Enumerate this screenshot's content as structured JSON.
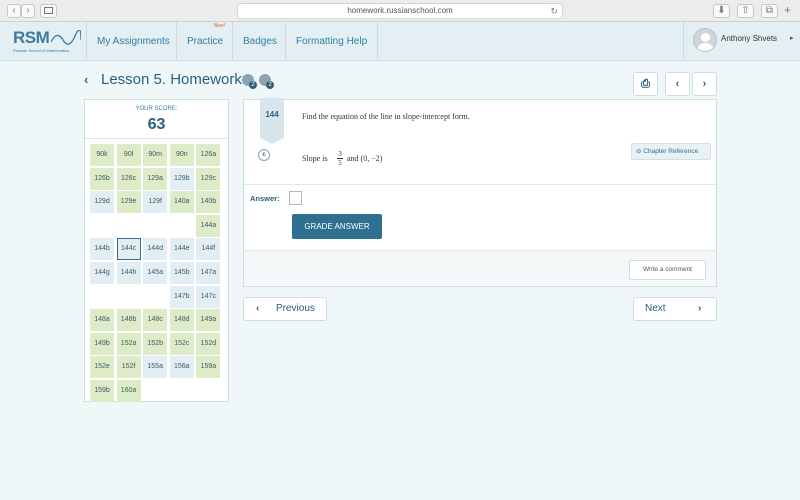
{
  "browser": {
    "url": "homework.russianschool.com",
    "back_glyph": "‹",
    "forward_glyph": "›",
    "reload_glyph": "↻",
    "download_glyph": "⬇",
    "share_glyph": "⇧",
    "tabs_glyph": "⧉",
    "plus_glyph": "+"
  },
  "logo": {
    "text": "RSM",
    "subtitle": "Russian School of Mathematics"
  },
  "nav": {
    "links": [
      {
        "label": "My Assignments"
      },
      {
        "label": "Practice",
        "badge": "New!"
      },
      {
        "label": "Badges"
      },
      {
        "label": "Formatting Help"
      }
    ],
    "user": {
      "name": "Anthony Shvets",
      "caret": "▸"
    }
  },
  "lesson": {
    "back_glyph": "‹",
    "title": "Lesson 5. Homework",
    "badges": [
      "2",
      "2"
    ],
    "print_glyph": "⎙",
    "prev_glyph": "‹",
    "next_glyph": "›"
  },
  "score": {
    "label": "YOUR SCORE:",
    "value": "63",
    "rows": [
      [
        {
          "t": "90k",
          "c": "g"
        },
        {
          "t": "90l",
          "c": "g"
        },
        {
          "t": "90m",
          "c": "g"
        },
        {
          "t": "90n",
          "c": "g"
        },
        {
          "t": "126a",
          "c": "g"
        }
      ],
      [
        {
          "t": "126b",
          "c": "g"
        },
        {
          "t": "126c",
          "c": "g"
        },
        {
          "t": "129a",
          "c": "g"
        },
        {
          "t": "129b",
          "c": "b"
        },
        {
          "t": "129c",
          "c": "g"
        }
      ],
      [
        {
          "t": "129d",
          "c": "b"
        },
        {
          "t": "129e",
          "c": "g"
        },
        {
          "t": "129f",
          "c": "b"
        },
        {
          "t": "140a",
          "c": "g"
        },
        {
          "t": "140b",
          "c": "g"
        }
      ],
      [
        {
          "t": "",
          "c": ""
        },
        {
          "t": "",
          "c": ""
        },
        {
          "t": "",
          "c": ""
        },
        {
          "t": "",
          "c": ""
        },
        {
          "t": "144a",
          "c": "g"
        }
      ],
      [
        {
          "t": "144b",
          "c": "b"
        },
        {
          "t": "144c",
          "c": "sel"
        },
        {
          "t": "144d",
          "c": "b"
        },
        {
          "t": "144e",
          "c": "b"
        },
        {
          "t": "144f",
          "c": "b"
        }
      ],
      [
        {
          "t": "144g",
          "c": "b"
        },
        {
          "t": "144h",
          "c": "b"
        },
        {
          "t": "145a",
          "c": "b"
        },
        {
          "t": "145b",
          "c": "b"
        },
        {
          "t": "147a",
          "c": "b"
        }
      ],
      [
        {
          "t": "",
          "c": ""
        },
        {
          "t": "",
          "c": ""
        },
        {
          "t": "",
          "c": ""
        },
        {
          "t": "147b",
          "c": "b"
        },
        {
          "t": "147c",
          "c": "b"
        }
      ],
      [
        {
          "t": "148a",
          "c": "g"
        },
        {
          "t": "148b",
          "c": "g"
        },
        {
          "t": "148c",
          "c": "g"
        },
        {
          "t": "148d",
          "c": "g"
        },
        {
          "t": "149a",
          "c": "g"
        }
      ],
      [
        {
          "t": "149b",
          "c": "g"
        },
        {
          "t": "152a",
          "c": "g"
        },
        {
          "t": "152b",
          "c": "g"
        },
        {
          "t": "152c",
          "c": "g"
        },
        {
          "t": "152d",
          "c": "g"
        }
      ],
      [
        {
          "t": "152e",
          "c": "g"
        },
        {
          "t": "152f",
          "c": "g"
        },
        {
          "t": "155a",
          "c": "b"
        },
        {
          "t": "156a",
          "c": "b"
        },
        {
          "t": "159a",
          "c": "g"
        }
      ],
      [
        {
          "t": "159b",
          "c": "g"
        },
        {
          "t": "160a",
          "c": "g"
        },
        {
          "t": "",
          "c": ""
        },
        {
          "t": "",
          "c": ""
        },
        {
          "t": "",
          "c": ""
        }
      ]
    ]
  },
  "problem": {
    "number": "144",
    "prompt": "Find the equation of the line in slope-intercept form.",
    "part": "c",
    "slope_prefix": "Slope is",
    "slope_num": "3",
    "slope_den": "5",
    "slope_suffix": "and (0, −2)",
    "chapter_ref": "Chapter Reference",
    "chapter_ref_glyph": "⊘",
    "answer_label": "Answer:",
    "grade_button": "GRADE ANSWER",
    "comment_button": "Write a comment"
  },
  "pager": {
    "previous": "Previous",
    "next": "Next",
    "prev_glyph": "‹",
    "next_glyph": "›"
  },
  "colors": {
    "accent": "#2f6f8f",
    "correct_cell": "#ddecc6",
    "pending_cell": "#e3eef4",
    "new_badge": "#e05a2b"
  }
}
